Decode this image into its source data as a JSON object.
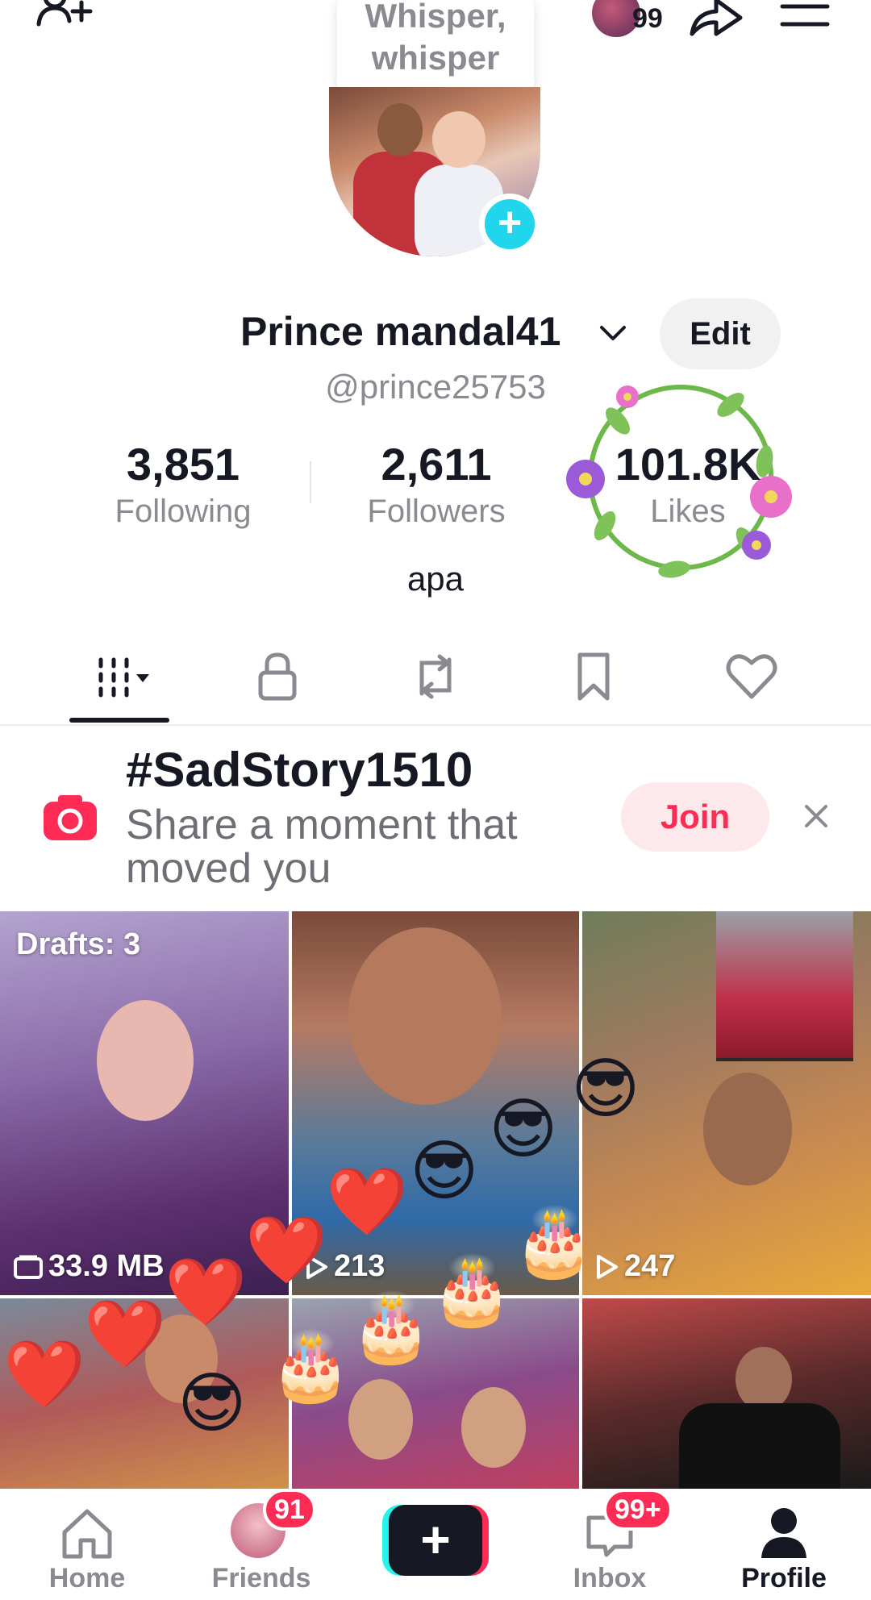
{
  "header": {
    "tooltip_line1": "Whisper,",
    "tooltip_line2": "whisper",
    "notification_count": "99",
    "icons": [
      "add-user-icon",
      "share-icon",
      "menu-icon"
    ]
  },
  "profile": {
    "display_name": "Prince mandal41",
    "handle": "@prince25753",
    "edit_label": "Edit",
    "bio": "apa",
    "stats": {
      "following_count": "3,851",
      "following_label": "Following",
      "followers_count": "2,611",
      "followers_label": "Followers",
      "likes_count": "101.8K",
      "likes_label": "Likes"
    }
  },
  "tabs": [
    {
      "name": "videos",
      "icon": "grid-icon",
      "active": true
    },
    {
      "name": "private",
      "icon": "lock-icon"
    },
    {
      "name": "reposts",
      "icon": "repost-icon"
    },
    {
      "name": "favorites",
      "icon": "bookmark-icon"
    },
    {
      "name": "liked",
      "icon": "heart-icon"
    }
  ],
  "challenge": {
    "hashtag": "#SadStory1510",
    "subtitle": "Share a moment that moved you",
    "join_label": "Join"
  },
  "videos": [
    {
      "label": "Drafts: 3",
      "meta": "33.9 MB"
    },
    {
      "meta": "213"
    },
    {
      "meta": "247"
    },
    {},
    {},
    {}
  ],
  "nav": {
    "home": "Home",
    "friends": "Friends",
    "friends_badge": "91",
    "inbox": "Inbox",
    "inbox_badge": "99+",
    "profile": "Profile"
  },
  "colors": {
    "accent_red": "#fe2c55",
    "accent_cyan": "#20d5ec",
    "text_primary": "#161823",
    "text_secondary": "#8a8b91"
  }
}
